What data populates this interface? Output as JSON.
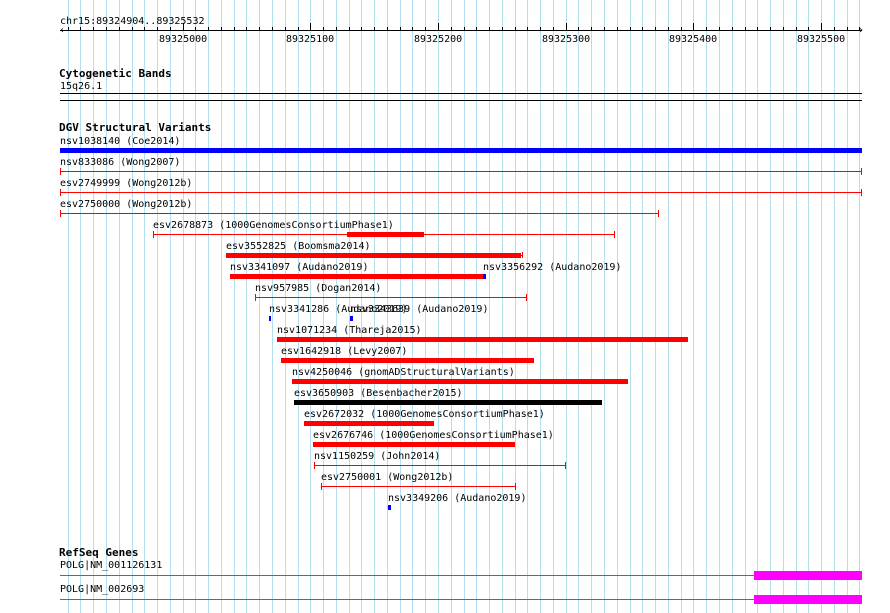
{
  "region": "chr15:89324904..89325532",
  "ruler": {
    "ticks": [
      {
        "label": "89325000",
        "bp": 89325000
      },
      {
        "label": "89325100",
        "bp": 89325100
      },
      {
        "label": "89325200",
        "bp": 89325200
      },
      {
        "label": "89325300",
        "bp": 89325300
      },
      {
        "label": "89325400",
        "bp": 89325400
      },
      {
        "label": "89325500",
        "bp": 89325500
      }
    ]
  },
  "cytoband": {
    "title": "Cytogenetic Bands",
    "band": "15q26.1"
  },
  "dgv": {
    "title": "DGV Structural Variants",
    "colors": {
      "loss": "#ff0000",
      "gain": "#0000ff",
      "complex": "#000000"
    },
    "variants": [
      {
        "label": "nsv1038140 (Coe2014)",
        "start": 89324904,
        "end": 89325532,
        "color": "#0000ff",
        "thick": true
      },
      {
        "label": "nsv833086 (Wong2007)",
        "start": 89324904,
        "end": 89325532,
        "color": "#ff0000",
        "thick": false
      },
      {
        "label": "esv2749999 (Wong2012b)",
        "start": 89324904,
        "end": 89325532,
        "color": "#ff0000",
        "thick": false
      },
      {
        "label": "esv2750000 (Wong2012b)",
        "start": 89324904,
        "end": 89325373,
        "color": "#ff0000",
        "thick": false
      },
      {
        "label": "esv2678873 (1000GenomesConsortiumPhase1)",
        "start": 89324977,
        "end": 89325339,
        "color": "#ff0000",
        "thick": false,
        "thickStart": 89325129,
        "thickEnd": 89325189
      },
      {
        "label": "esv3552825 (Boomsma2014)",
        "start": 89325034,
        "end": 89325265,
        "color": "#ff0000",
        "thick": true,
        "thinEnd": 89325266
      },
      {
        "label": "nsv3341097 (Audano2019)",
        "start": 89325037,
        "end": 89325235,
        "color": "#ff0000",
        "thick": true
      },
      {
        "label": "nsv3356292 (Audano2019)",
        "start": 89325235,
        "end": 89325237,
        "color": "#0000ff",
        "thick": true,
        "sameRow": true
      },
      {
        "label": "nsv957985 (Dogan2014)",
        "start": 89325057,
        "end": 89325270,
        "color": "#ff0000",
        "thick": false
      },
      {
        "label": "nsv3341286 (Audano2019)",
        "start": 89325068,
        "end": 89325069,
        "color": "#0000ff",
        "thick": true
      },
      {
        "label": "nsv3343639 (Audano2019)",
        "start": 89325131,
        "end": 89325133,
        "color": "#0000ff",
        "thick": true,
        "sameRow": true
      },
      {
        "label": "nsv1071234 (Thareja2015)",
        "start": 89325074,
        "end": 89325396,
        "color": "#ff0000",
        "thick": true
      },
      {
        "label": "esv1642918 (Levy2007)",
        "start": 89325077,
        "end": 89325275,
        "color": "#ff0000",
        "thick": true
      },
      {
        "label": "nsv4250046 (gnomADStructuralVariants)",
        "start": 89325086,
        "end": 89325349,
        "color": "#ff0000",
        "thick": true
      },
      {
        "label": "esv3650903 (Besenbacher2015)",
        "start": 89325087,
        "end": 89325328,
        "color": "#000000",
        "thick": true
      },
      {
        "label": "esv2672032 (1000GenomesConsortiumPhase1)",
        "start": 89325095,
        "end": 89325197,
        "color": "#ff0000",
        "thick": true
      },
      {
        "label": "esv2676746 (1000GenomesConsortiumPhase1)",
        "start": 89325102,
        "end": 89325260,
        "color": "#ff0000",
        "thick": true
      },
      {
        "label": "nsv1150259 (John2014)",
        "start": 89325103,
        "end": 89325300,
        "color": "#ff0000",
        "thick": false
      },
      {
        "label": "esv2750001 (Wong2012b)",
        "start": 89325108,
        "end": 89325261,
        "color": "#ff0000",
        "thick": false
      },
      {
        "label": "nsv3349206 (Audano2019)",
        "start": 89325161,
        "end": 89325163,
        "color": "#0000ff",
        "thick": true
      }
    ]
  },
  "refseq": {
    "title": "RefSeq Genes",
    "color": "#ff00ff",
    "genes": [
      {
        "label": "POLG|NM_001126131"
      },
      {
        "label": "POLG|NM_002693"
      }
    ]
  }
}
